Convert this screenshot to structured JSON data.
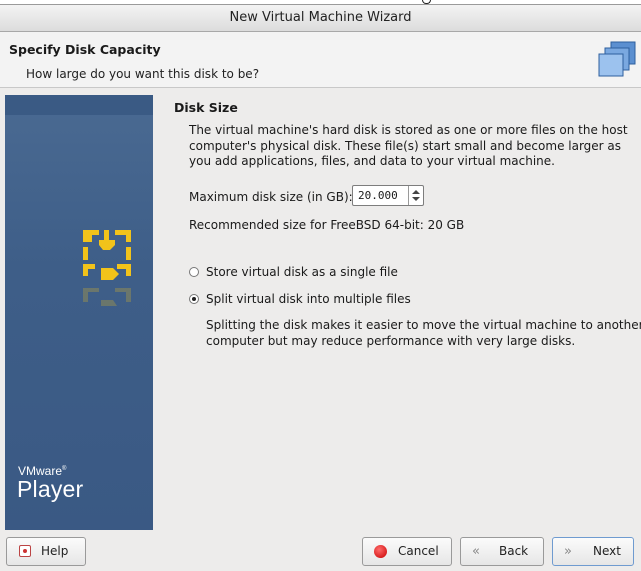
{
  "window": {
    "title": "New Virtual Machine Wizard"
  },
  "header": {
    "title": "Specify Disk Capacity",
    "subtitle": "How large do you want this disk to be?",
    "icon": "stacked-disks-icon"
  },
  "sidebar": {
    "brand": "VMware",
    "brand_mark": "®",
    "product": "Player",
    "icon": "vmware-logo-icon"
  },
  "disk": {
    "section_title": "Disk Size",
    "description": "The virtual machine's hard disk is stored as one or more files on the host computer's physical disk. These file(s) start small and become larger as you add applications, files, and data to your virtual machine.",
    "max_size_label": "Maximum disk size (in GB):",
    "max_size_value": "20.000",
    "recommended": "Recommended size for FreeBSD 64-bit: 20 GB"
  },
  "storage_options": [
    {
      "label": "Store virtual disk as a single file",
      "selected": false
    },
    {
      "label": "Split virtual disk into multiple files",
      "selected": true
    }
  ],
  "split_note": "Splitting the disk makes it easier to move the virtual machine to another computer but may reduce performance with very large disks.",
  "buttons": {
    "help": "Help",
    "cancel": "Cancel",
    "back": "Back",
    "next": "Next"
  },
  "colors": {
    "sidebar": "#3e5e88",
    "logo_yellow": "#f2c31a",
    "cancel_red": "#d40000",
    "focus_border": "#6f9bd0"
  }
}
